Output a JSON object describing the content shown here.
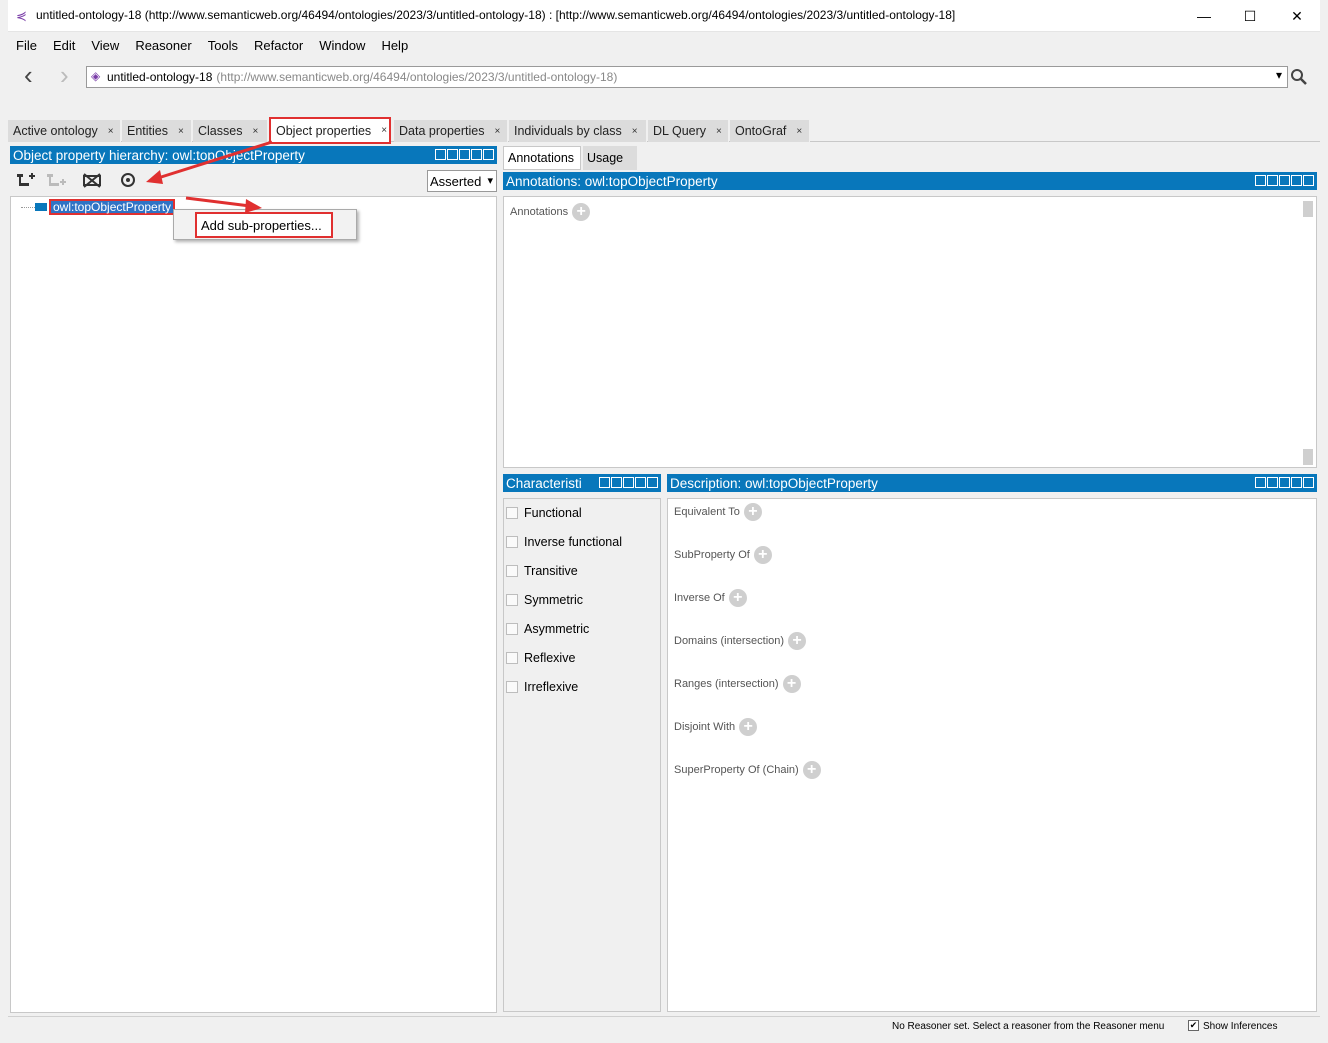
{
  "window": {
    "title": "untitled-ontology-18 (http://www.semanticweb.org/46494/ontologies/2023/3/untitled-ontology-18)  : [http://www.semanticweb.org/46494/ontologies/2023/3/untitled-ontology-18]",
    "minimize": "—",
    "maximize": "☐",
    "close": "✕"
  },
  "menu": [
    "File",
    "Edit",
    "View",
    "Reasoner",
    "Tools",
    "Refactor",
    "Window",
    "Help"
  ],
  "nav": {
    "back": "‹",
    "forward": "›",
    "ontology_name": "untitled-ontology-18",
    "ontology_uri": "(http://www.semanticweb.org/46494/ontologies/2023/3/untitled-ontology-18)",
    "dropdown": "▾",
    "search_icon": "search-icon"
  },
  "tabs": [
    {
      "label": "Active ontology",
      "close": "×"
    },
    {
      "label": "Entities",
      "close": "×"
    },
    {
      "label": "Classes",
      "close": "×"
    },
    {
      "label": "Object properties",
      "close": "×",
      "active": true
    },
    {
      "label": "Data properties",
      "close": "×"
    },
    {
      "label": "Individuals by class",
      "close": "×"
    },
    {
      "label": "DL Query",
      "close": "×"
    },
    {
      "label": "OntoGraf",
      "close": "×"
    }
  ],
  "hierarchy": {
    "title": "Object property hierarchy: owl:topObjectProperty",
    "mode": "Asserted",
    "root": "owl:topObjectProperty",
    "context_menu_item": "Add sub-properties..."
  },
  "right_tabs": [
    "Annotations",
    "Usage"
  ],
  "annotations": {
    "title": "Annotations: owl:topObjectProperty",
    "label": "Annotations"
  },
  "characteristics": {
    "title": "Characteristi",
    "items": [
      "Functional",
      "Inverse functional",
      "Transitive",
      "Symmetric",
      "Asymmetric",
      "Reflexive",
      "Irreflexive"
    ]
  },
  "description": {
    "title": "Description: owl:topObjectProperty",
    "items": [
      "Equivalent To",
      "SubProperty Of",
      "Inverse Of",
      "Domains (intersection)",
      "Ranges (intersection)",
      "Disjoint With",
      "SuperProperty Of (Chain)"
    ]
  },
  "status": {
    "message": "No Reasoner set. Select a reasoner from the Reasoner menu",
    "show_inferences": "Show Inferences"
  },
  "colors": {
    "panel_header": "#0877bb",
    "highlight": "#e03030"
  }
}
